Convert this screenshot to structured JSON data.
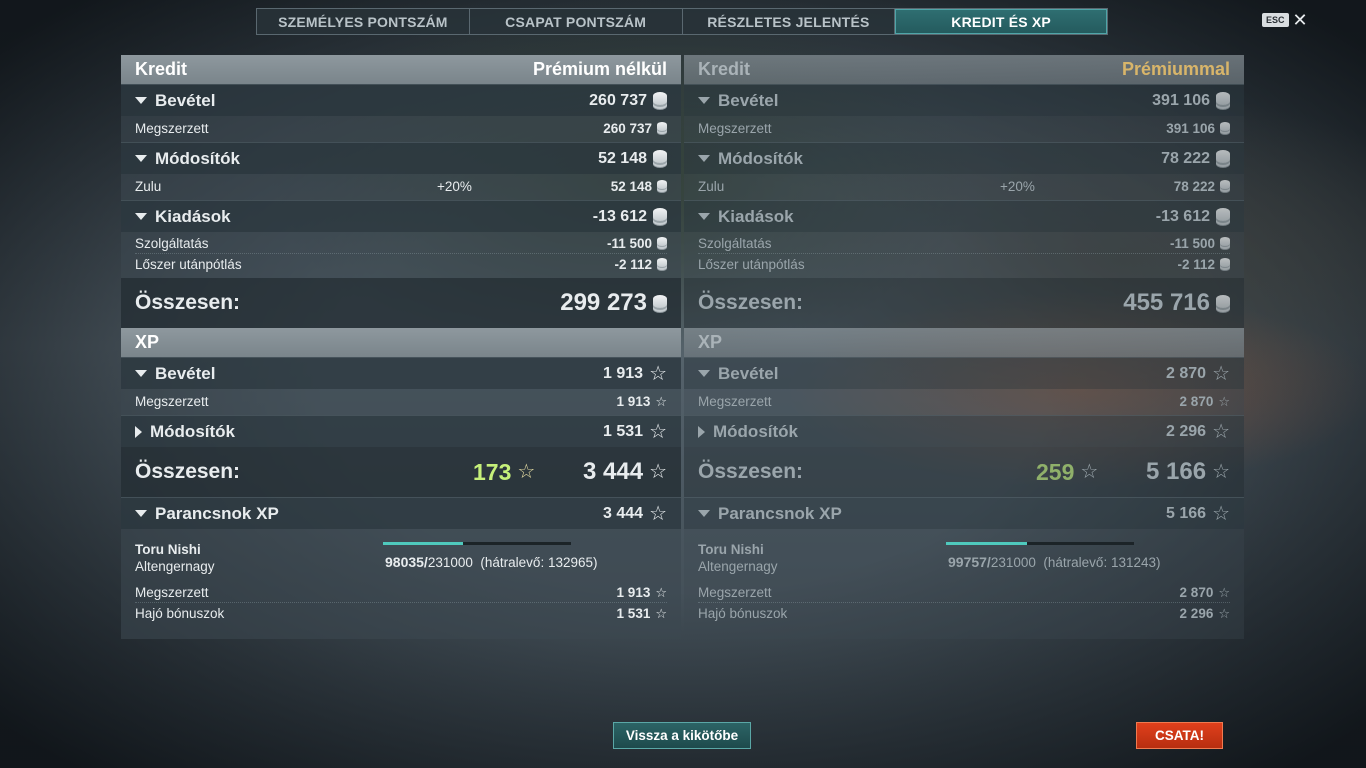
{
  "tabs": [
    {
      "label": "SZEMÉLYES PONTSZÁM",
      "active": false
    },
    {
      "label": "CSAPAT PONTSZÁM",
      "active": false
    },
    {
      "label": "RÉSZLETES JELENTÉS",
      "active": false
    },
    {
      "label": "KREDIT ÉS XP",
      "active": true
    }
  ],
  "esc_label": "ESC",
  "left": {
    "credit_header": "Kredit",
    "credit_mode": "Prémium nélkül",
    "income_label": "Bevétel",
    "income_value": "260 737",
    "earned_label": "Megszerzett",
    "earned_value": "260 737",
    "modifiers_label": "Módosítók",
    "modifiers_value": "52 148",
    "zulu_label": "Zulu",
    "zulu_pct": "+20%",
    "zulu_value": "52 148",
    "expenses_label": "Kiadások",
    "expenses_value": "-13 612",
    "service_label": "Szolgáltatás",
    "service_value": "-11 500",
    "ammo_label": "Lőszer utánpótlás",
    "ammo_value": "-2 112",
    "total_label": "Összesen:",
    "total_value": "299 273",
    "xp_header": "XP",
    "xp_income_label": "Bevétel",
    "xp_income_value": "1 913",
    "xp_earned_label": "Megszerzett",
    "xp_earned_value": "1 913",
    "xp_mod_label": "Módosítók",
    "xp_mod_value": "1 531",
    "xp_total_label": "Összesen:",
    "xp_free_value": "173",
    "xp_total_value": "3 444",
    "cmd_header": "Parancsnok XP",
    "cmd_value": "3 444",
    "cmd_name": "Toru Nishi",
    "cmd_rank": "Altengernagy",
    "cmd_xp_current": "98035/",
    "cmd_xp_max": "231000",
    "cmd_remaining": "(hátralevő: 132965)",
    "cmd_progress": 0.424,
    "cmd_earned_label": "Megszerzett",
    "cmd_earned_value": "1 913",
    "cmd_bonus_label": "Hajó bónuszok",
    "cmd_bonus_value": "1 531"
  },
  "right": {
    "credit_header": "Kredit",
    "credit_mode": "Prémiummal",
    "income_label": "Bevétel",
    "income_value": "391 106",
    "earned_label": "Megszerzett",
    "earned_value": "391 106",
    "modifiers_label": "Módosítók",
    "modifiers_value": "78 222",
    "zulu_label": "Zulu",
    "zulu_pct": "+20%",
    "zulu_value": "78 222",
    "expenses_label": "Kiadások",
    "expenses_value": "-13 612",
    "service_label": "Szolgáltatás",
    "service_value": "-11 500",
    "ammo_label": "Lőszer utánpótlás",
    "ammo_value": "-2 112",
    "total_label": "Összesen:",
    "total_value": "455 716",
    "xp_header": "XP",
    "xp_income_label": "Bevétel",
    "xp_income_value": "2 870",
    "xp_earned_label": "Megszerzett",
    "xp_earned_value": "2 870",
    "xp_mod_label": "Módosítók",
    "xp_mod_value": "2 296",
    "xp_total_label": "Összesen:",
    "xp_free_value": "259",
    "xp_total_value": "5 166",
    "cmd_header": "Parancsnok XP",
    "cmd_value": "5 166",
    "cmd_name": "Toru Nishi",
    "cmd_rank": "Altengernagy",
    "cmd_xp_current": "99757/",
    "cmd_xp_max": "231000",
    "cmd_remaining": "(hátralevő: 131243)",
    "cmd_progress": 0.432,
    "cmd_earned_label": "Megszerzett",
    "cmd_earned_value": "2 870",
    "cmd_bonus_label": "Hajó bónuszok",
    "cmd_bonus_value": "2 296"
  },
  "buttons": {
    "back_label": "Vissza a kikötőbe",
    "battle_label": "CSATA!"
  },
  "colors": {
    "accent_teal": "#2f6f72",
    "battle_red": "#d63a18",
    "free_xp_green": "#c6f07a",
    "premium_gold": "#d8b56a"
  }
}
